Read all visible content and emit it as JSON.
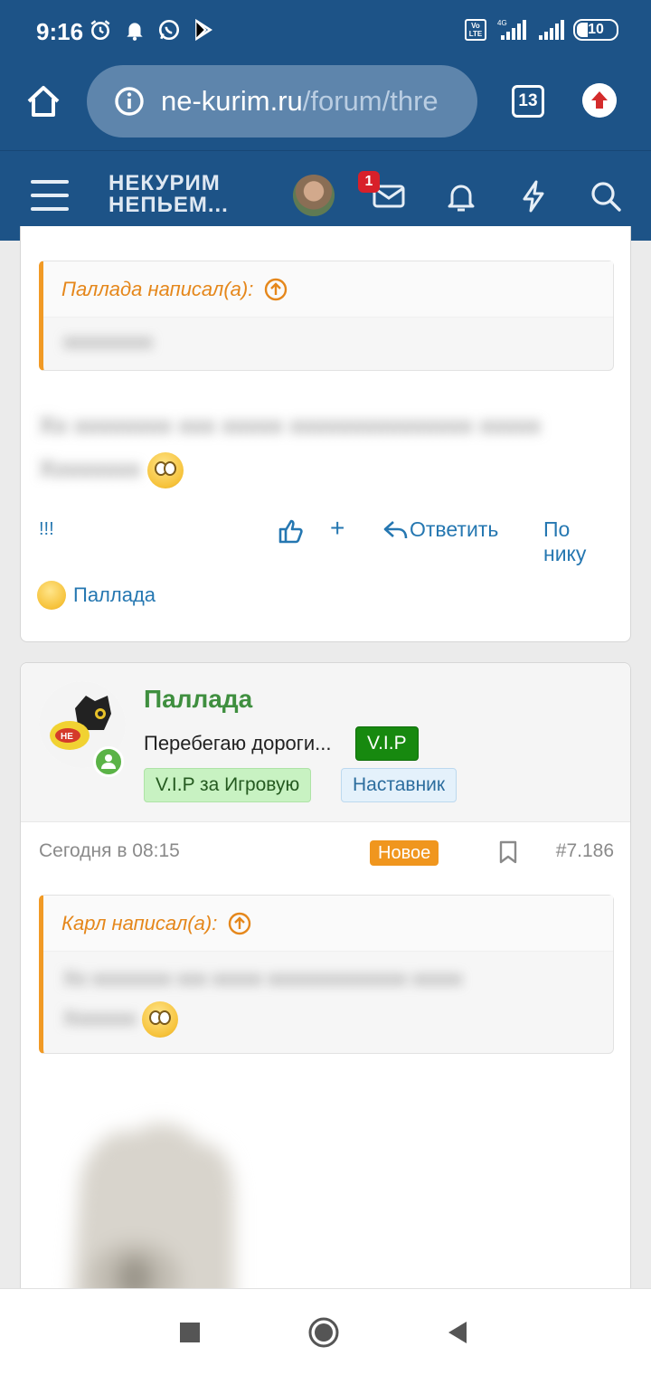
{
  "status": {
    "time": "9:16",
    "network": "4G",
    "volte": "Vo LTE",
    "battery": "10"
  },
  "browser": {
    "url_host": "ne-kurim.ru",
    "url_path": "/forum/thre",
    "tab_count": "13"
  },
  "forum": {
    "logo_line1": "НЕКУРИМ",
    "logo_line2": "НЕПЬЕМ...",
    "inbox_badge": "1"
  },
  "post1": {
    "quote_author": "Паллада написал(а):",
    "quote_text": "xxxxxxxxx",
    "body_line1": "Xx xxxxxxxx xxx xxxxx xxxxxxxxxxxxxxx xxxxx",
    "body_line2": "Xxxxxxxx",
    "exclaim": "!!!",
    "plus": "+",
    "reply": "Ответить",
    "by_nick": "По нику",
    "reaction_user": "Паллада"
  },
  "post2": {
    "username": "Паллада",
    "user_title": "Перебегаю дороги...",
    "tag_vip": "V.I.P",
    "tag_game": "V.I.P за Игровую",
    "tag_mentor": "Наставник",
    "date": "Сегодня в 08:15",
    "new_label": "Новое",
    "post_number": "#7.186",
    "quote_author": "Карл написал(а):",
    "quote_line1": "Xx xxxxxxxx xxx xxxxx xxxxxxxxxxxxxx xxxxx",
    "quote_line2": "Xxxxxxx"
  },
  "colors": {
    "header": "#1d5387",
    "accent_orange": "#f0961e",
    "link_blue": "#2577b1",
    "username_green": "#3f8f3f"
  }
}
